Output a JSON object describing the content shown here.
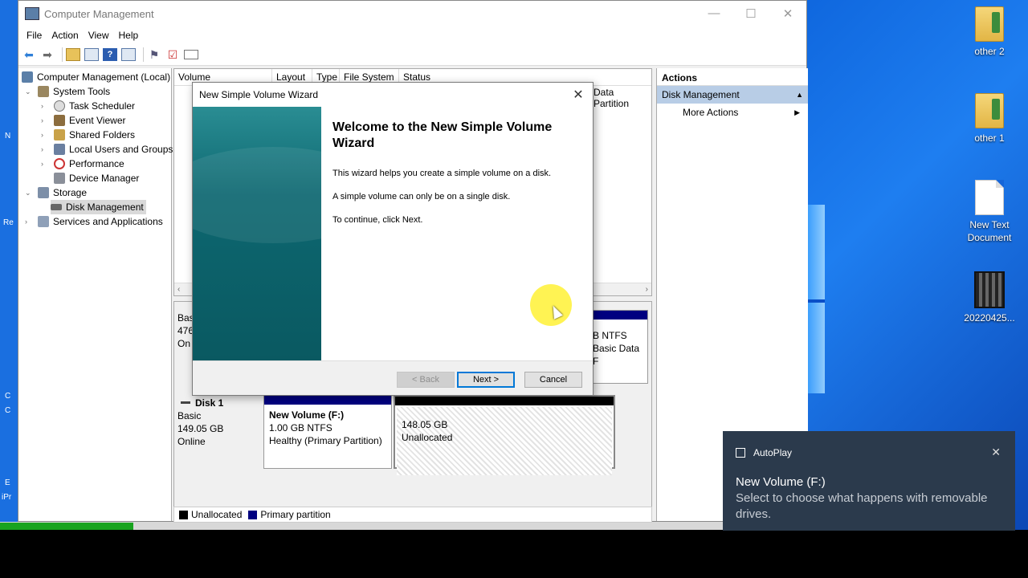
{
  "desktop": {
    "icons": [
      {
        "label": "other 2",
        "icon": "folder-icon"
      },
      {
        "label": "other 1",
        "icon": "folder-icon"
      },
      {
        "label": "New Text Document",
        "icon": "text-document-icon"
      },
      {
        "label": "20220425...",
        "icon": "video-file-icon"
      }
    ],
    "left_fragments": [
      "N",
      "Re",
      "C",
      "C",
      "E",
      "iPr"
    ]
  },
  "window": {
    "title": "Computer Management",
    "controls": {
      "minimize": "—",
      "maximize": "☐",
      "close": "✕"
    }
  },
  "menu": {
    "file": "File",
    "action": "Action",
    "view": "View",
    "help": "Help"
  },
  "tree": {
    "root": "Computer Management (Local)",
    "system_tools": "System Tools",
    "task_scheduler": "Task Scheduler",
    "event_viewer": "Event Viewer",
    "shared_folders": "Shared Folders",
    "local_users": "Local Users and Groups",
    "performance": "Performance",
    "device_manager": "Device Manager",
    "storage": "Storage",
    "disk_management": "Disk Management",
    "services": "Services and Applications"
  },
  "volume_table": {
    "columns": [
      "Volume",
      "Layout",
      "Type",
      "File System",
      "Status"
    ],
    "status_fragment": "Data Partition"
  },
  "disk0": {
    "info": [
      "Bas",
      "476",
      "On"
    ],
    "part_lines": [
      "B NTFS",
      "Basic Data F"
    ]
  },
  "disk1": {
    "name": "Disk 1",
    "type": "Basic",
    "size": "149.05 GB",
    "status": "Online",
    "partitions": [
      {
        "title": "New Volume  (F:)",
        "line1": "1.00 GB NTFS",
        "line2": "Healthy (Primary Partition)"
      },
      {
        "title": "",
        "line1": "148.05 GB",
        "line2": "Unallocated"
      }
    ]
  },
  "legend": {
    "unallocated": "Unallocated",
    "primary": "Primary partition"
  },
  "actions": {
    "header": "Actions",
    "section": "Disk Management",
    "more": "More Actions"
  },
  "wizard": {
    "title": "New Simple Volume Wizard",
    "heading": "Welcome to the New Simple Volume Wizard",
    "p1": "This wizard helps you create a simple volume on a disk.",
    "p2": "A simple volume can only be on a single disk.",
    "p3": "To continue, click Next.",
    "back": "< Back",
    "next": "Next >",
    "cancel": "Cancel"
  },
  "toast": {
    "app": "AutoPlay",
    "title": "New Volume (F:)",
    "message": "Select to choose what happens with removable drives."
  },
  "colors": {
    "primary_partition": "#000080",
    "unallocated": "#000000",
    "actions_highlight": "#b8cde6",
    "wizard_side": "#0d6770"
  }
}
